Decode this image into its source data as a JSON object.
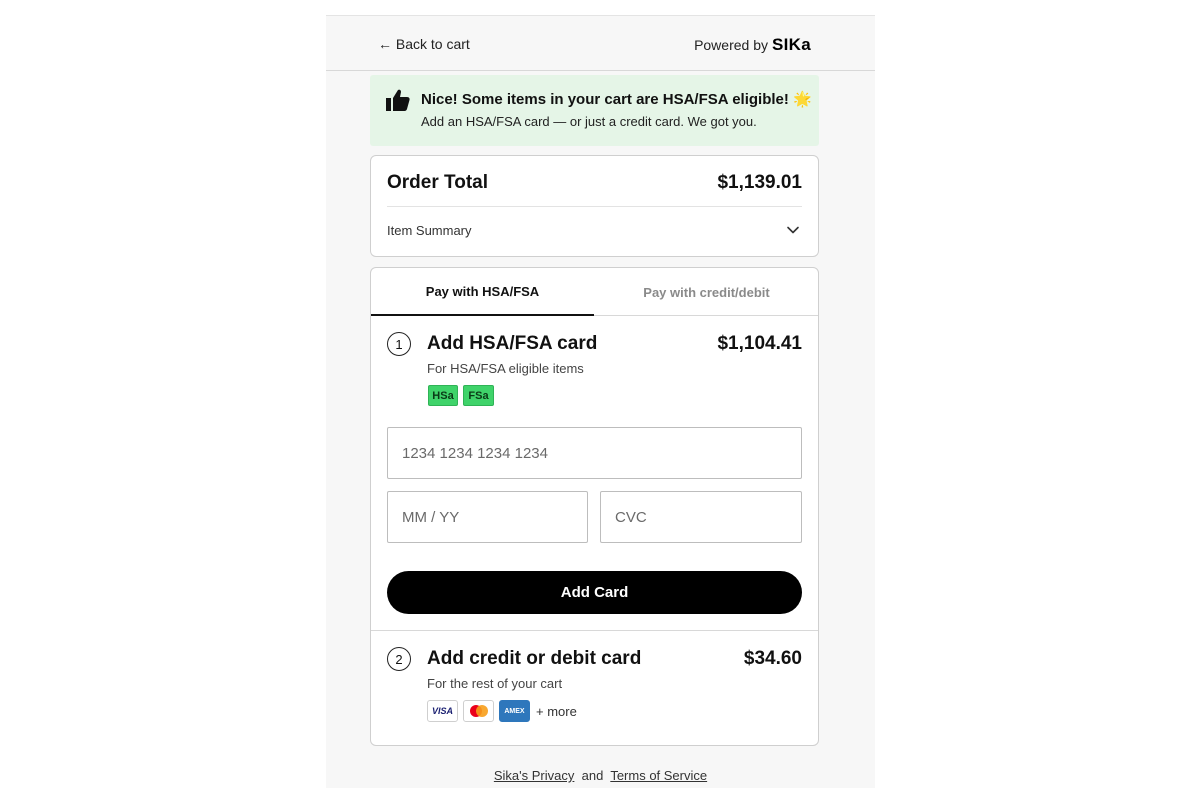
{
  "header": {
    "back_label": "← Back to cart",
    "powered_prefix": "Powered by",
    "brand": "SIKa"
  },
  "banner": {
    "title": "Nice! Some items in your cart are HSA/FSA eligible! 🌟",
    "subtitle": "Add an HSA/FSA card — or just a credit card. We got you.",
    "icon": "thumbs-up-icon",
    "bg_color": "#e5f5e7"
  },
  "order": {
    "total_label": "Order Total",
    "total_value": "$1,139.01",
    "summary_label": "Item Summary"
  },
  "tabs": [
    {
      "label": "Pay with HSA/FSA",
      "active": true
    },
    {
      "label": "Pay with credit/debit",
      "active": false
    }
  ],
  "step1": {
    "number": "1",
    "title": "Add HSA/FSA card",
    "amount": "$1,104.41",
    "subtitle": "For HSA/FSA eligible items",
    "badges": [
      "HSa",
      "FSa"
    ],
    "card_number_placeholder": "1234 1234 1234 1234",
    "expiry_placeholder": "MM / YY",
    "cvc_placeholder": "CVC",
    "button_label": "Add Card"
  },
  "step2": {
    "number": "2",
    "title": "Add credit or debit card",
    "amount": "$34.60",
    "subtitle": "For the rest of your cart",
    "card_brands": [
      "VISA",
      "mastercard",
      "AMEX"
    ],
    "more_label": "+ more"
  },
  "footer": {
    "privacy_label": "Sika's Privacy",
    "and_label": "and",
    "terms_label": "Terms of Service"
  },
  "colors": {
    "accent": "#000000",
    "badge_green": "#3fd36a",
    "amex_blue": "#2e77bc"
  }
}
